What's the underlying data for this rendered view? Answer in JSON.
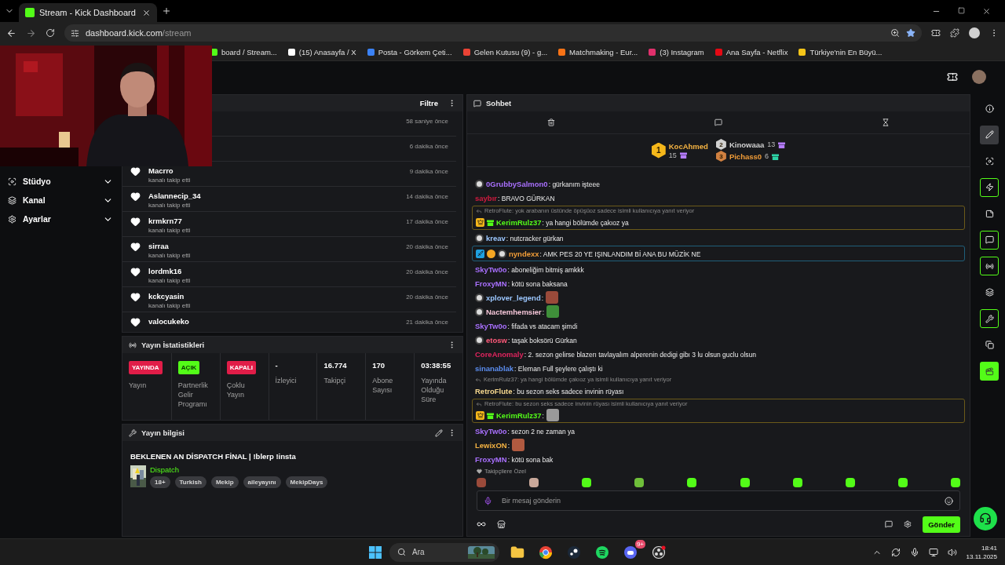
{
  "browser": {
    "tabs": [
      {
        "title": "Stream - Kick Dashboard",
        "selected": true
      }
    ],
    "url_host": "dashboard.kick.com",
    "url_path": "/stream",
    "bookmarks": [
      {
        "label": "board / Stream...",
        "color": "#53fc18"
      },
      {
        "label": "(15) Anasayfa / X",
        "color": "#ffffff"
      },
      {
        "label": "Posta - Görkem Çeti...",
        "color": "#3b82f6"
      },
      {
        "label": "Gelen Kutusu (9) - g...",
        "color": "#ea4335"
      },
      {
        "label": "Matchmaking - Eur...",
        "color": "#f97316"
      },
      {
        "label": "(3) Instagram",
        "color": "#e1306c"
      },
      {
        "label": "Ana Sayfa - Netflix",
        "color": "#e50914"
      },
      {
        "label": "Türkiye'nin En Büyü...",
        "color": "#f5c518"
      }
    ]
  },
  "sidebar": {
    "items": [
      {
        "label": "Stüdyo"
      },
      {
        "label": "Kanal"
      },
      {
        "label": "Ayarlar"
      }
    ]
  },
  "activity": {
    "filter": "Filtre",
    "rows": [
      {
        "time": "58 saniye önce"
      },
      {
        "time": "6 dakika önce"
      },
      {
        "name": "Macrro",
        "action": "kanalı takip etti",
        "time": "9 dakika önce"
      },
      {
        "name": "Aslannecip_34",
        "action": "kanalı takip etti",
        "time": "14 dakika önce"
      },
      {
        "name": "krmkrn77",
        "action": "kanalı takip etti",
        "time": "17 dakika önce"
      },
      {
        "name": "sirraa",
        "action": "kanalı takip etti",
        "time": "20 dakika önce"
      },
      {
        "name": "lordmk16",
        "action": "kanalı takip etti",
        "time": "20 dakika önce"
      },
      {
        "name": "kckcyasin",
        "action": "kanalı takip etti",
        "time": "20 dakika önce"
      },
      {
        "name": "valocukeko",
        "time": "21 dakika önce"
      }
    ]
  },
  "stats": {
    "title": "Yayın İstatistikleri",
    "cells": [
      {
        "badge": "YAYINDA",
        "color": "#e11d48",
        "label": "Yayın"
      },
      {
        "badge": "AÇIK",
        "color": "#53fc18",
        "label": "Partnerlik Gelir Programı"
      },
      {
        "badge": "KAPALI",
        "color": "#e11d48",
        "label": "Çoklu Yayın"
      },
      {
        "value": "-",
        "label": "İzleyici"
      },
      {
        "value": "16.774",
        "label": "Takipçi"
      },
      {
        "value": "170",
        "label": "Abone Sayısı"
      },
      {
        "value": "03:38:55",
        "label": "Yayında Olduğu Süre"
      }
    ]
  },
  "stream_info": {
    "title_header": "Yayın bilgisi",
    "title": "BEKLENEN AN DİSPATCH FİNAL | !blerp !insta",
    "category": "Dispatch",
    "tags": [
      "18+",
      "Turkish",
      "Mekip",
      "aileyayını",
      "MekipDays"
    ]
  },
  "chat": {
    "title": "Sohbet",
    "leaders": [
      {
        "rank": "1",
        "name": "KocAhmed",
        "count": "15",
        "color": "#b57cff"
      },
      {
        "rank": "2",
        "name": "Kinowaaa",
        "count": "13",
        "color": "#b57cff"
      },
      {
        "rank": "3",
        "name": "Pichass0",
        "count": "6",
        "color": "#2dd4a7"
      }
    ],
    "messages": [
      {
        "kind": "plain",
        "avatar": true,
        "user": "0GrubbySalmon0",
        "color": "#a970ff",
        "text": ": gürkanım işteee"
      },
      {
        "kind": "plain",
        "user": "saybır",
        "color": "#d11a3f",
        "text": ": BRAVO GÜRKAN"
      },
      {
        "kind": "mention",
        "reply": "RetroFlute: yok arabanın üstünde öpüşüoz sadece isimli kullanıcıya yanıt veriyor",
        "subscriber": true,
        "user": "KerimRulz37",
        "color": "#53fc18",
        "text": ": ya hangi bölümde çakıoz ya"
      },
      {
        "kind": "plain",
        "avatar": true,
        "user": "kreav",
        "color": "#9cc7ff",
        "text": ": nutcracker gürkan"
      },
      {
        "kind": "highlight",
        "moderator": true,
        "rank": true,
        "avatar": true,
        "user": "nyndexx",
        "color": "#f29d38",
        "text": ": AMK PES 20 YE IŞINLANDIM Bİ ANA BU MÜZİK NE"
      },
      {
        "kind": "plain",
        "user": "SkyTw0o",
        "color": "#a970ff",
        "text": ": aboneliğim bitmiş amkkk"
      },
      {
        "kind": "plain",
        "user": "FroxyMN",
        "color": "#a970ff",
        "text": ": kötü sona baksana"
      },
      {
        "kind": "plain",
        "avatar": true,
        "user": "xplover_legend",
        "color": "#9cc7ff",
        "text": ":",
        "emote": {
          "color": "#9a4a3a"
        }
      },
      {
        "kind": "plain",
        "avatar": true,
        "user": "Nactemhemsier",
        "color": "#f5c6d8",
        "text": ":",
        "emote": {
          "color": "#3f8f3a"
        }
      },
      {
        "kind": "plain",
        "user": "SkyTw0o",
        "color": "#a970ff",
        "text": ": fifada vs atacam şimdi"
      },
      {
        "kind": "plain",
        "avatar": true,
        "user": "etosw",
        "color": "#ff5a7a",
        "text": ": taşak boksörü Gürkan"
      },
      {
        "kind": "plain",
        "user": "CoreAnomaly",
        "color": "#e0245e",
        "text": ": 2. sezon gelirse blazerı tavlayalım alperenin dedigi gibı 3 lu olsun guclu olsun"
      },
      {
        "kind": "plain",
        "user": "sinanablak",
        "color": "#5b8def",
        "text": ": Eleman Full şeylere çalıştı ki"
      },
      {
        "kind": "reply",
        "reply": "KerimRulz37: ya hangi bölümde çakıoz ya isimli kullanıcıya yanıt veriyor",
        "user": "RetroFlute",
        "color": "#f5d78e",
        "text": ": bu sezon seks sadece invinin rüyası"
      },
      {
        "kind": "mention",
        "reply": "RetroFlute: bu sezon seks sadece invinin rüyası isimli kullanıcıya yanıt veriyor",
        "subscriber": true,
        "user": "KerimRulz37",
        "color": "#53fc18",
        "text": ":",
        "emote": {
          "color": "#9a9a9a"
        }
      },
      {
        "kind": "plain",
        "user": "SkyTw0o",
        "color": "#a970ff",
        "text": ": sezon 2 ne zaman ya"
      },
      {
        "kind": "plain",
        "user": "LewixON",
        "color": "#f5b342",
        "text": ":",
        "emote": {
          "color": "#b05a40"
        }
      },
      {
        "kind": "plain",
        "user": "FroxyMN",
        "color": "#a970ff",
        "text": ": kötü sona bak"
      }
    ],
    "emote_section": "Takipçilere Özel",
    "emotes": [
      {
        "color": "#9a4a3a"
      },
      {
        "color": "#c9a89a"
      },
      {
        "color": "#53fc18"
      },
      {
        "color": "#6fbf3a"
      },
      {
        "color": "#53fc18"
      },
      {
        "color": "#53fc18"
      },
      {
        "color": "#53fc18"
      },
      {
        "color": "#53fc18"
      },
      {
        "color": "#53fc18"
      },
      {
        "color": "#53fc18"
      }
    ],
    "input": {
      "placeholder": "Bir mesaj gönderin"
    },
    "send": "Gönder"
  },
  "rail": [
    {
      "selected": false,
      "pinned": false
    },
    {
      "selected": true,
      "pinned": false
    },
    {
      "selected": false,
      "pinned": false
    },
    {
      "selected": false,
      "pinned": true
    },
    {
      "selected": false,
      "pinned": false
    },
    {
      "selected": false,
      "pinned": true
    },
    {
      "selected": false,
      "pinned": true
    },
    {
      "selected": false,
      "pinned": false
    },
    {
      "selected": false,
      "pinned": true
    },
    {
      "selected": false,
      "pinned": false
    }
  ],
  "taskbar": {
    "search": {
      "placeholder": "Ara"
    },
    "notification": "9+",
    "time": "18:41",
    "date": "13.11.2025"
  }
}
